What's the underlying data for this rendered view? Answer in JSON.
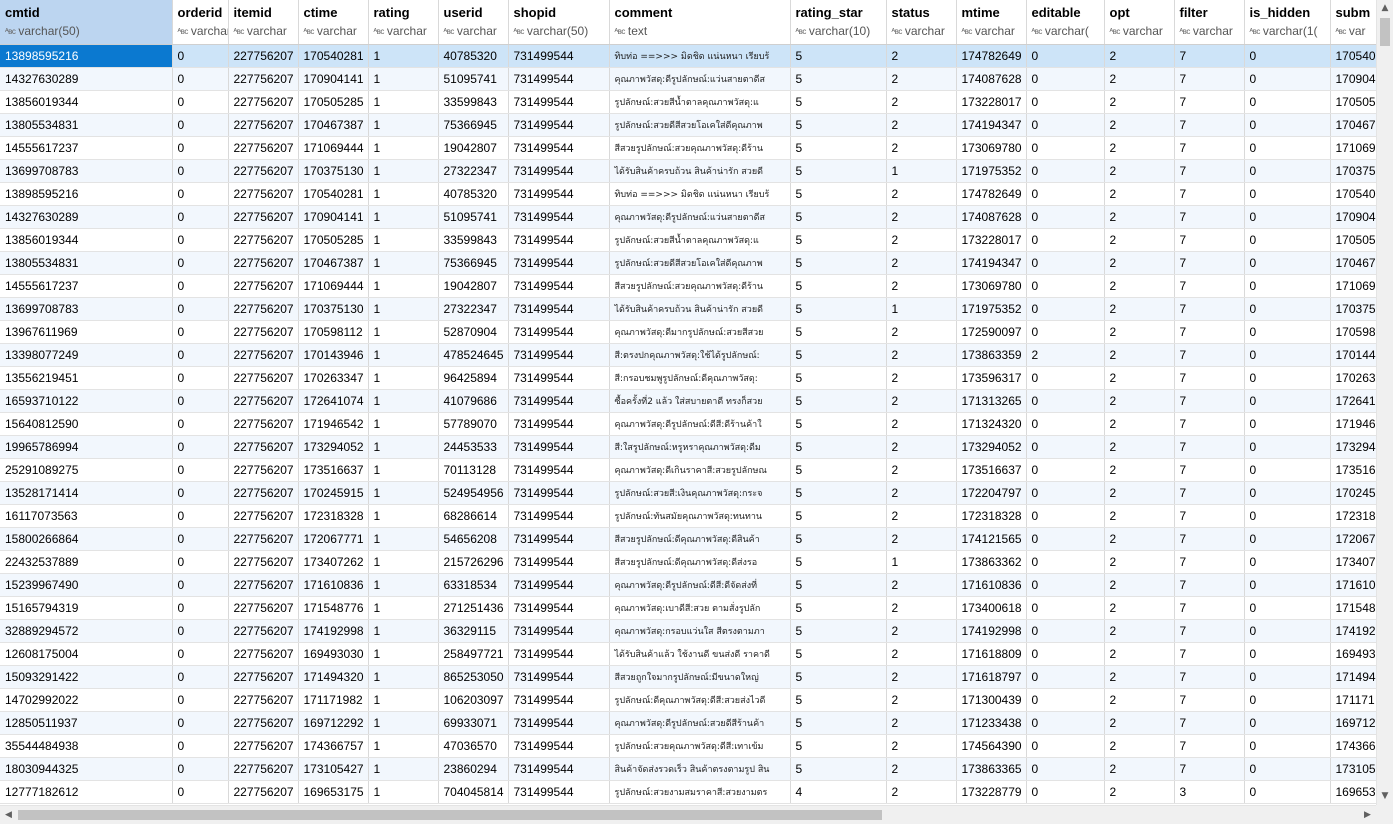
{
  "columns": [
    {
      "name": "cmtid",
      "type": "varchar(50)",
      "w": 172
    },
    {
      "name": "orderid",
      "type": "varchar",
      "w": 56
    },
    {
      "name": "itemid",
      "type": "varchar",
      "w": 70
    },
    {
      "name": "ctime",
      "type": "varchar",
      "w": 70
    },
    {
      "name": "rating",
      "type": "varchar",
      "w": 70
    },
    {
      "name": "userid",
      "type": "varchar",
      "w": 70
    },
    {
      "name": "shopid",
      "type": "varchar(50)",
      "w": 101
    },
    {
      "name": "comment",
      "type": "text",
      "w": 181
    },
    {
      "name": "rating_star",
      "type": "varchar(10)",
      "w": 96
    },
    {
      "name": "status",
      "type": "varchar",
      "w": 70
    },
    {
      "name": "mtime",
      "type": "varchar",
      "w": 70
    },
    {
      "name": "editable",
      "type": "varchar(",
      "w": 78
    },
    {
      "name": "opt",
      "type": "varchar",
      "w": 70
    },
    {
      "name": "filter",
      "type": "varchar",
      "w": 70
    },
    {
      "name": "is_hidden",
      "type": "varchar(1(",
      "w": 86
    },
    {
      "name": "subm",
      "type": "var",
      "w": 70
    }
  ],
  "rows": [
    [
      "13898595216",
      "0",
      "227756207",
      "170540281",
      "1",
      "40785320",
      "731499544",
      "ทิบท่อ ==>>> มิดชิด แน่นหนา เรียบร้",
      "5",
      "2",
      "174782649",
      "0",
      "2",
      "7",
      "0",
      "170540"
    ],
    [
      "14327630289",
      "0",
      "227756207",
      "170904141",
      "1",
      "51095741",
      "731499544",
      "คุณภาพวัสดุ:ดีรูปลักษณ์:แว่นสายตาดีส",
      "5",
      "2",
      "174087628",
      "0",
      "2",
      "7",
      "0",
      "170904"
    ],
    [
      "13856019344",
      "0",
      "227756207",
      "170505285",
      "1",
      "33599843",
      "731499544",
      "รูปลักษณ์:สวยสีน้ำตาลคุณภาพวัสดุ:แ",
      "5",
      "2",
      "173228017",
      "0",
      "2",
      "7",
      "0",
      "170505"
    ],
    [
      "13805534831",
      "0",
      "227756207",
      "170467387",
      "1",
      "75366945",
      "731499544",
      "รูปลักษณ์:สวยดีสีสวยโอเคใส่ดีคุณภาพ",
      "5",
      "2",
      "174194347",
      "0",
      "2",
      "7",
      "0",
      "170467"
    ],
    [
      "14555617237",
      "0",
      "227756207",
      "171069444",
      "1",
      "19042807",
      "731499544",
      "สีสวยรูปลักษณ์:สวยคุณภาพวัสดุ:ดีร้าน",
      "5",
      "2",
      "173069780",
      "0",
      "2",
      "7",
      "0",
      "171069"
    ],
    [
      "13699708783",
      "0",
      "227756207",
      "170375130",
      "1",
      "27322347",
      "731499544",
      "ได้รับสินค้าครบถ้วน สินค้าน่ารัก สวยดี",
      "5",
      "1",
      "171975352",
      "0",
      "2",
      "7",
      "0",
      "170375"
    ],
    [
      "13898595216",
      "0",
      "227756207",
      "170540281",
      "1",
      "40785320",
      "731499544",
      "ทิบท่อ ==>>> มิดชิด แน่นหนา เรียบร้",
      "5",
      "2",
      "174782649",
      "0",
      "2",
      "7",
      "0",
      "170540"
    ],
    [
      "14327630289",
      "0",
      "227756207",
      "170904141",
      "1",
      "51095741",
      "731499544",
      "คุณภาพวัสดุ:ดีรูปลักษณ์:แว่นสายตาดีส",
      "5",
      "2",
      "174087628",
      "0",
      "2",
      "7",
      "0",
      "170904"
    ],
    [
      "13856019344",
      "0",
      "227756207",
      "170505285",
      "1",
      "33599843",
      "731499544",
      "รูปลักษณ์:สวยสีน้ำตาลคุณภาพวัสดุ:แ",
      "5",
      "2",
      "173228017",
      "0",
      "2",
      "7",
      "0",
      "170505"
    ],
    [
      "13805534831",
      "0",
      "227756207",
      "170467387",
      "1",
      "75366945",
      "731499544",
      "รูปลักษณ์:สวยดีสีสวยโอเคใส่ดีคุณภาพ",
      "5",
      "2",
      "174194347",
      "0",
      "2",
      "7",
      "0",
      "170467"
    ],
    [
      "14555617237",
      "0",
      "227756207",
      "171069444",
      "1",
      "19042807",
      "731499544",
      "สีสวยรูปลักษณ์:สวยคุณภาพวัสดุ:ดีร้าน",
      "5",
      "2",
      "173069780",
      "0",
      "2",
      "7",
      "0",
      "171069"
    ],
    [
      "13699708783",
      "0",
      "227756207",
      "170375130",
      "1",
      "27322347",
      "731499544",
      "ได้รับสินค้าครบถ้วน สินค้าน่ารัก สวยดี",
      "5",
      "1",
      "171975352",
      "0",
      "2",
      "7",
      "0",
      "170375"
    ],
    [
      "13967611969",
      "0",
      "227756207",
      "170598112",
      "1",
      "52870904",
      "731499544",
      "คุณภาพวัสดุ:ดีมากรูปลักษณ์:สวยสีสวย",
      "5",
      "2",
      "172590097",
      "0",
      "2",
      "7",
      "0",
      "170598"
    ],
    [
      "13398077249",
      "0",
      "227756207",
      "170143946",
      "1",
      "478524645",
      "731499544",
      "สี:ตรงปกคุณภาพวัสดุ:ใช้ได้รูปลักษณ์:",
      "5",
      "2",
      "173863359",
      "2",
      "2",
      "7",
      "0",
      "170144"
    ],
    [
      "13556219451",
      "0",
      "227756207",
      "170263347",
      "1",
      "96425894",
      "731499544",
      "สี:กรอบชมพูรูปลักษณ์:ดีคุณภาพวัสดุ:",
      "5",
      "2",
      "173596317",
      "0",
      "2",
      "7",
      "0",
      "170263"
    ],
    [
      "16593710122",
      "0",
      "227756207",
      "172641074",
      "1",
      "41079686",
      "731499544",
      "ซื้อครั้งที่2 แล้ว ใส่สบายตาดี ทรงก็สวย",
      "5",
      "2",
      "171313265",
      "0",
      "2",
      "7",
      "0",
      "172641"
    ],
    [
      "15640812590",
      "0",
      "227756207",
      "171946542",
      "1",
      "57789070",
      "731499544",
      "คุณภาพวัสดุ:ดีรูปลักษณ์:ดีสี:ดีร้านค้าใ",
      "5",
      "2",
      "171324320",
      "0",
      "2",
      "7",
      "0",
      "171946"
    ],
    [
      "19965786994",
      "0",
      "227756207",
      "173294052",
      "1",
      "24453533",
      "731499544",
      "สี:ใสรูปลักษณ์:หรูหราคุณภาพวัสดุ:ดีม",
      "5",
      "2",
      "173294052",
      "0",
      "2",
      "7",
      "0",
      "173294"
    ],
    [
      "25291089275",
      "0",
      "227756207",
      "173516637",
      "1",
      "70113128",
      "731499544",
      "คุณภาพวัสดุ:ดีเกินราคาสี:สวยรูปลักษณ",
      "5",
      "2",
      "173516637",
      "0",
      "2",
      "7",
      "0",
      "173516"
    ],
    [
      "13528171414",
      "0",
      "227756207",
      "170245915",
      "1",
      "524954956",
      "731499544",
      "รูปลักษณ์:สวยสี:เงินคุณภาพวัสดุ:กระจ",
      "5",
      "2",
      "172204797",
      "0",
      "2",
      "7",
      "0",
      "170245"
    ],
    [
      "16117073563",
      "0",
      "227756207",
      "172318328",
      "1",
      "68286614",
      "731499544",
      "รูปลักษณ์:ทันสมัยคุณภาพวัสดุ:ทนทาน",
      "5",
      "2",
      "172318328",
      "0",
      "2",
      "7",
      "0",
      "172318"
    ],
    [
      "15800266864",
      "0",
      "227756207",
      "172067771",
      "1",
      "54656208",
      "731499544",
      "สีสวยรูปลักษณ์:ดีคุณภาพวัสดุ:ดีสินค้า",
      "5",
      "2",
      "174121565",
      "0",
      "2",
      "7",
      "0",
      "172067"
    ],
    [
      "22432537889",
      "0",
      "227756207",
      "173407262",
      "1",
      "215726296",
      "731499544",
      "สีสวยรูปลักษณ์:ดีคุณภาพวัสดุ:ดีส่งรอ",
      "5",
      "1",
      "173863362",
      "0",
      "2",
      "7",
      "0",
      "173407"
    ],
    [
      "15239967490",
      "0",
      "227756207",
      "171610836",
      "1",
      "63318534",
      "731499544",
      "คุณภาพวัสดุ:ดีรูปลักษณ์:ดีสี:ดีจัดส่งที่",
      "5",
      "2",
      "171610836",
      "0",
      "2",
      "7",
      "0",
      "171610"
    ],
    [
      "15165794319",
      "0",
      "227756207",
      "171548776",
      "1",
      "271251436",
      "731499544",
      "คุณภาพวัสดุ:เบาดีสี:สวย ตามสั่งรูปลัก",
      "5",
      "2",
      "173400618",
      "0",
      "2",
      "7",
      "0",
      "171548"
    ],
    [
      "32889294572",
      "0",
      "227756207",
      "174192998",
      "1",
      "36329115",
      "731499544",
      "คุณภาพวัสดุ:กรอบแว่นใส สีตรงตามภา",
      "5",
      "2",
      "174192998",
      "0",
      "2",
      "7",
      "0",
      "174192"
    ],
    [
      "12608175004",
      "0",
      "227756207",
      "169493030",
      "1",
      "258497721",
      "731499544",
      "ได้รับสินค้าแล้ว ใช้งานดี ขนส่งดี ราคาดี",
      "5",
      "2",
      "171618809",
      "0",
      "2",
      "7",
      "0",
      "169493"
    ],
    [
      "15093291422",
      "0",
      "227756207",
      "171494320",
      "1",
      "865253050",
      "731499544",
      "สีสวยถูกใจมากรูปลักษณ์:มีขนาดใหญ่",
      "5",
      "2",
      "171618797",
      "0",
      "2",
      "7",
      "0",
      "171494"
    ],
    [
      "14702992022",
      "0",
      "227756207",
      "171171982",
      "1",
      "106203097",
      "731499544",
      "รูปลักษณ์:ดีคุณภาพวัสดุ:ดีสี:สวยส่งไวดี",
      "5",
      "2",
      "171300439",
      "0",
      "2",
      "7",
      "0",
      "171171"
    ],
    [
      "12850511937",
      "0",
      "227756207",
      "169712292",
      "1",
      "69933071",
      "731499544",
      "คุณภาพวัสดุ:ดีรูปลักษณ์:สวยดีสีร้านค้า",
      "5",
      "2",
      "171233438",
      "0",
      "2",
      "7",
      "0",
      "169712"
    ],
    [
      "35544484938",
      "0",
      "227756207",
      "174366757",
      "1",
      "47036570",
      "731499544",
      "รูปลักษณ์:สวยคุณภาพวัสดุ:ดีสี:เทาเข้ม",
      "5",
      "2",
      "174564390",
      "0",
      "2",
      "7",
      "0",
      "174366"
    ],
    [
      "18030944325",
      "0",
      "227756207",
      "173105427",
      "1",
      "23860294",
      "731499544",
      "สินค้าจัดส่งรวดเร็ว สินค้าตรงตามรูป สิน",
      "5",
      "2",
      "173863365",
      "0",
      "2",
      "7",
      "0",
      "173105"
    ],
    [
      "12777182612",
      "0",
      "227756207",
      "169653175",
      "1",
      "704045814",
      "731499544",
      "รูปลักษณ์:สวยงามสมราคาสี:สวยงามตร",
      "4",
      "2",
      "173228779",
      "0",
      "2",
      "3",
      "0",
      "169653"
    ]
  ],
  "type_prefix": "ᴬʙc",
  "scroll": {
    "up": "▲",
    "down": "▼",
    "left": "◀",
    "right": "▶"
  },
  "colors": {
    "selected_cell": "#0b79d0",
    "selected_row": "#cde4f8",
    "header_selected": "#bcd5f0",
    "alt_row": "#f2f7fd"
  }
}
